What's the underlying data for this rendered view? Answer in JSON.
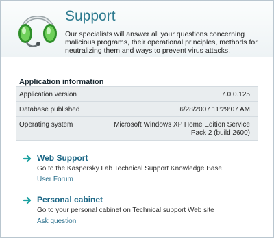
{
  "header": {
    "title": "Support",
    "description": "Our specialists will answer all your questions concerning malicious programs, their operational principles, methods for neutralizing them and ways to prevent virus attacks."
  },
  "app_info": {
    "title": "Application information",
    "rows": [
      {
        "label": "Application version",
        "value": "7.0.0.125"
      },
      {
        "label": "Database published",
        "value": "6/28/2007 11:29:07 AM"
      },
      {
        "label": "Operating system",
        "value": "Microsoft Windows XP Home Edition Service Pack 2 (build 2600)"
      }
    ]
  },
  "links": [
    {
      "title": "Web Support",
      "description": "Go to the Kaspersky Lab Technical Support Knowledge Base.",
      "sublink": "User Forum"
    },
    {
      "title": "Personal cabinet",
      "description": "Go to your personal cabinet on Technical support Web site",
      "sublink": "Ask question"
    }
  ],
  "colors": {
    "accent": "#2d7a8f",
    "link": "#1c6786",
    "arrow": "#1aa0a0",
    "headset_green": "#4caf3c"
  },
  "icons": {
    "header_icon": "headset-icon",
    "link_icon": "arrow-right-icon"
  }
}
